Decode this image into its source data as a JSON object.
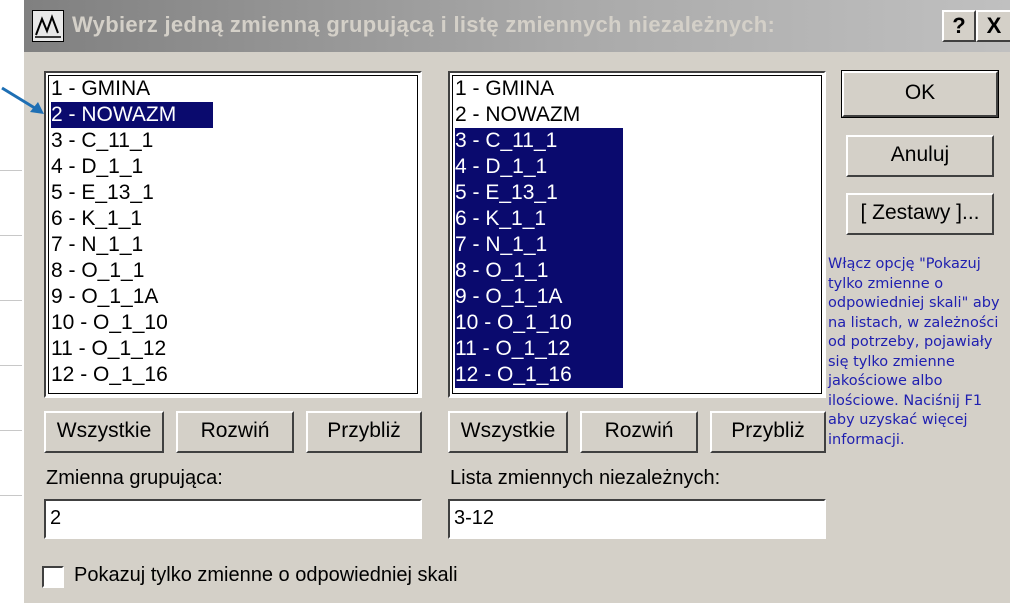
{
  "dialog": {
    "title": "Wybierz jedną zmienną grupującą i listę zmiennych niezależnych:",
    "help_label": "?",
    "close_label": "X"
  },
  "left_list": {
    "items": [
      "1 - GMINA",
      "2 - NOWAZM",
      "3 - C_11_1",
      "4 - D_1_1",
      "5 - E_13_1",
      "6 - K_1_1",
      "7 - N_1_1",
      "8 - O_1_1",
      "9 - O_1_1A",
      "10 - O_1_10",
      "11 - O_1_12",
      "12 - O_1_16"
    ],
    "selected": [
      2
    ]
  },
  "right_list": {
    "items": [
      "1 - GMINA",
      "2 - NOWAZM",
      "3 - C_11_1",
      "4 - D_1_1",
      "5 - E_13_1",
      "6 - K_1_1",
      "7 - N_1_1",
      "8 - O_1_1",
      "9 - O_1_1A",
      "10 - O_1_10",
      "11 - O_1_12",
      "12 - O_1_16"
    ],
    "selected": [
      3,
      4,
      5,
      6,
      7,
      8,
      9,
      10,
      11,
      12
    ]
  },
  "buttons": {
    "all": "Wszystkie",
    "expand": "Rozwiń",
    "zoom": "Przybliż",
    "ok": "OK",
    "cancel": "Anuluj",
    "sets": "[ Zestawy ]..."
  },
  "grouping": {
    "label": "Zmienna grupująca:",
    "value": "2"
  },
  "independent": {
    "label": "Lista zmiennych niezależnych:",
    "value": "3-12"
  },
  "hint": "Włącz opcję \"Pokazuj tylko zmienne o odpowiedniej skali\" aby na listach, w zależności od potrzeby, pojawiały się tylko zmienne jakościowe albo ilościowe. Naciśnij F1 aby uzyskać więcej informacji.",
  "checkbox": {
    "label": "Pokazuj tylko zmienne o odpowiedniej skali",
    "checked": false
  },
  "colors": {
    "selection": "#0a0a6e",
    "hint_text": "#2020b0",
    "arrow": "#1e6fb4"
  }
}
